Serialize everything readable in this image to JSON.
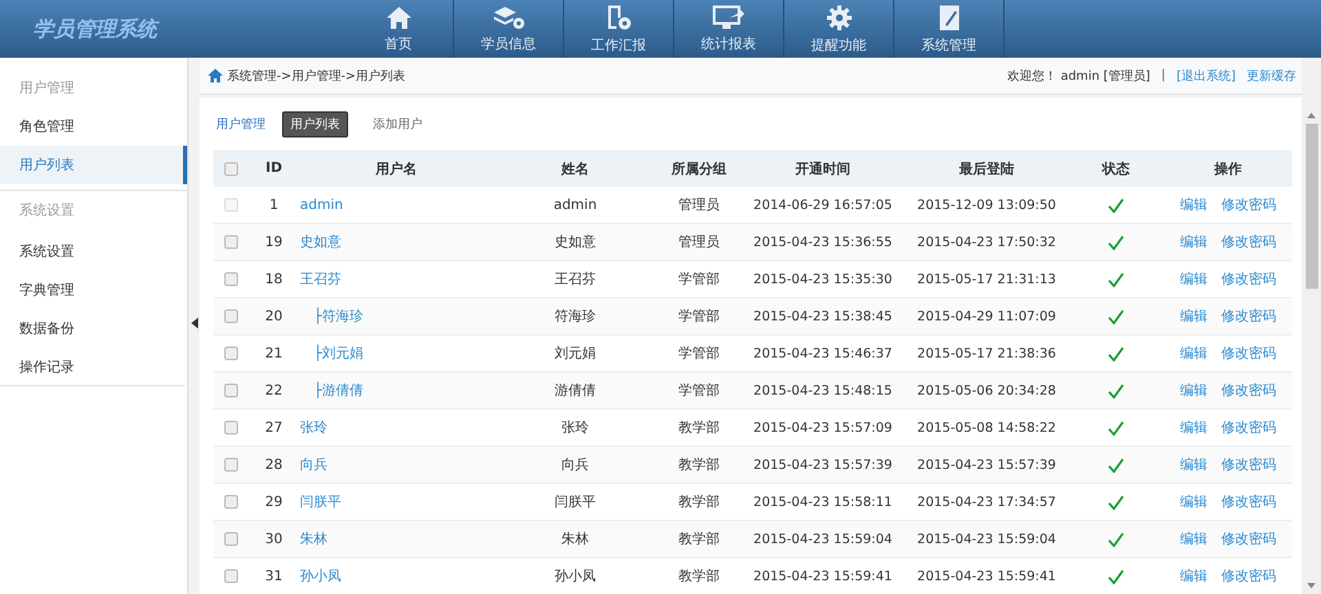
{
  "app": {
    "title": "学员管理系统"
  },
  "nav": [
    {
      "label": "首页"
    },
    {
      "label": "学员信息"
    },
    {
      "label": "工作汇报"
    },
    {
      "label": "统计报表"
    },
    {
      "label": "提醒功能"
    },
    {
      "label": "系统管理"
    }
  ],
  "sidebar": [
    {
      "heading": "用户管理",
      "items": [
        {
          "label": "角色管理",
          "selected": false
        },
        {
          "label": "用户列表",
          "selected": true
        }
      ]
    },
    {
      "heading": "系统设置",
      "items": [
        {
          "label": "系统设置",
          "selected": false
        },
        {
          "label": "字典管理",
          "selected": false
        },
        {
          "label": "数据备份",
          "selected": false
        },
        {
          "label": "操作记录",
          "selected": false
        }
      ]
    }
  ],
  "breadcrumb": "系统管理->用户管理->用户列表",
  "user_bar": {
    "welcome": "欢迎您！ admin [管理员]",
    "separator": "|",
    "logout": "[退出系统]",
    "refresh": "更新缓存"
  },
  "section_title": "用户管理",
  "tabs": [
    {
      "label": "用户列表",
      "selected": true
    },
    {
      "label": "添加用户",
      "selected": false
    }
  ],
  "table": {
    "select_all_checked": false,
    "columns": [
      "ID",
      "用户名",
      "姓名",
      "所属分组",
      "开通时间",
      "最后登陆",
      "状态",
      "操作"
    ],
    "rows": [
      {
        "id": "1",
        "username": "admin",
        "name": "admin",
        "group": "管理员",
        "created": "2014-06-29 16:57:05",
        "last_login": "2015-12-09 13:09:50",
        "active": true,
        "disabled": true,
        "actions": [
          "编辑",
          "修改密码"
        ]
      },
      {
        "id": "19",
        "username": "史如意",
        "name": "史如意",
        "group": "管理员",
        "created": "2015-04-23 15:36:55",
        "last_login": "2015-04-23 17:50:32",
        "active": true,
        "disabled": false,
        "actions": [
          "编辑",
          "修改密码"
        ]
      },
      {
        "id": "18",
        "username": "王召芬",
        "name": "王召芬",
        "group": "学管部",
        "created": "2015-04-23 15:35:30",
        "last_login": "2015-05-17 21:31:13",
        "active": true,
        "disabled": false,
        "actions": [
          "编辑",
          "修改密码"
        ],
        "children": [
          {
            "id": "20",
            "username": "├符海珍",
            "name": "符海珍",
            "group": "学管部",
            "created": "2015-04-23 15:38:45",
            "last_login": "2015-04-29 11:07:09",
            "active": true,
            "disabled": false,
            "actions": [
              "编辑",
              "修改密码"
            ]
          },
          {
            "id": "21",
            "username": "├刘元娟",
            "name": "刘元娟",
            "group": "学管部",
            "created": "2015-04-23 15:46:37",
            "last_login": "2015-05-17 21:38:36",
            "active": true,
            "disabled": false,
            "actions": [
              "编辑",
              "修改密码"
            ]
          },
          {
            "id": "22",
            "username": "├游倩倩",
            "name": "游倩倩",
            "group": "学管部",
            "created": "2015-04-23 15:48:15",
            "last_login": "2015-05-06 20:34:28",
            "active": true,
            "disabled": false,
            "actions": [
              "编辑",
              "修改密码"
            ]
          }
        ]
      },
      {
        "id": "27",
        "username": "张玲",
        "name": "张玲",
        "group": "教学部",
        "created": "2015-04-23 15:57:09",
        "last_login": "2015-05-08 14:58:22",
        "active": true,
        "disabled": false,
        "actions": [
          "编辑",
          "修改密码"
        ]
      },
      {
        "id": "28",
        "username": "向兵",
        "name": "向兵",
        "group": "教学部",
        "created": "2015-04-23 15:57:39",
        "last_login": "2015-04-23 15:57:39",
        "active": true,
        "disabled": false,
        "actions": [
          "编辑",
          "修改密码"
        ]
      },
      {
        "id": "29",
        "username": "闫朕平",
        "name": "闫朕平",
        "group": "教学部",
        "created": "2015-04-23 15:58:11",
        "last_login": "2015-04-23 17:34:57",
        "active": true,
        "disabled": false,
        "actions": [
          "编辑",
          "修改密码"
        ]
      },
      {
        "id": "30",
        "username": "朱林",
        "name": "朱林",
        "group": "教学部",
        "created": "2015-04-23 15:59:04",
        "last_login": "2015-04-23 15:59:04",
        "active": true,
        "disabled": false,
        "actions": [
          "编辑",
          "修改密码"
        ]
      },
      {
        "id": "31",
        "username": "孙小凤",
        "name": "孙小凤",
        "group": "教学部",
        "created": "2015-04-23 15:59:41",
        "last_login": "2015-04-23 15:59:41",
        "active": true,
        "disabled": false,
        "actions": [
          "编辑",
          "修改密码"
        ]
      }
    ]
  }
}
